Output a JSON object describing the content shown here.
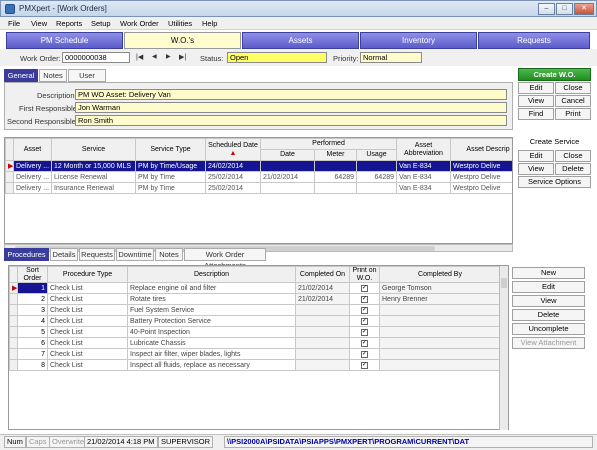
{
  "window": {
    "title": "PMXpert - [Work Orders]",
    "min": "–",
    "max": "□",
    "close": "✕"
  },
  "menu": [
    "File",
    "View",
    "Reports",
    "Setup",
    "Work Order",
    "Utilities",
    "Help"
  ],
  "main_tabs": [
    "PM Schedule",
    "W.O.'s",
    "Assets",
    "Inventory",
    "Requests"
  ],
  "order": {
    "work_order_label": "Work Order:",
    "work_order_value": "0000000038",
    "nav": [
      "|◀",
      "◀",
      "▶",
      "▶|"
    ],
    "status_label": "Status:",
    "status_value": "Open",
    "priority_label": "Priority:",
    "priority_value": "Normal"
  },
  "general_tabs": [
    "General",
    "Notes",
    "User Fields"
  ],
  "general": {
    "description_label": "Description:",
    "description_value": "PM WO Asset: Delivery Van",
    "first_resp_label": "First Responsible:",
    "first_resp_value": "Jon Warman",
    "second_resp_label": "Second Responsible:",
    "second_resp_value": "Ron Smith"
  },
  "wo_buttons": {
    "create": "Create W.O.",
    "edit": "Edit",
    "close": "Close",
    "view": "View",
    "cancel": "Cancel",
    "find": "Find",
    "print": "Print"
  },
  "service_buttons": {
    "create": "Create Service",
    "edit": "Edit",
    "close": "Close",
    "view": "View",
    "delete": "Delete",
    "options": "Service Options"
  },
  "grid1": {
    "headers": {
      "asset": "Asset",
      "service": "Service",
      "service_type": "Service Type",
      "scheduled": "Scheduled Date",
      "performed": "Performed",
      "date": "Date",
      "meter": "Meter",
      "usage": "Usage",
      "abbrev": "Asset Abbreviation",
      "desc": "Asset Descrip"
    },
    "rows": [
      {
        "asset": "Delivery ...",
        "service": "12 Month or 15,000 MLS",
        "type": "PM by Time/Usage",
        "scheduled": "24/02/2014",
        "date": "",
        "meter": "",
        "usage": "",
        "abbrev": "Van E-834",
        "desc": "Westpro Delive"
      },
      {
        "asset": "Delivery ...",
        "service": "License Renewal",
        "type": "PM by Time",
        "scheduled": "25/02/2014",
        "date": "21/02/2014",
        "meter": "64289",
        "usage": "64289",
        "abbrev": "Van E-834",
        "desc": "Westpro Delive"
      },
      {
        "asset": "Delivery ...",
        "service": "Insurance Renewal",
        "type": "PM by Time",
        "scheduled": "25/02/2014",
        "date": "",
        "meter": "",
        "usage": "",
        "abbrev": "Van E-834",
        "desc": "Westpro Delive"
      }
    ]
  },
  "proc_tabs": [
    "Procedures",
    "Details",
    "Requests",
    "Downtime",
    "Notes",
    "Work Order Attachments"
  ],
  "grid2": {
    "headers": {
      "sort": "Sort Order",
      "type": "Procedure Type",
      "desc": "Description",
      "completed_on": "Completed On",
      "print": "Print on W.O.",
      "completed_by": "Completed By"
    },
    "rows": [
      {
        "sort": "1",
        "type": "Check List",
        "desc": "Replace engine oil and filter",
        "on": "21/02/2014",
        "print": "✓",
        "by": "George Tomson"
      },
      {
        "sort": "2",
        "type": "Check List",
        "desc": "Rotate tires",
        "on": "21/02/2014",
        "print": "✓",
        "by": "Henry Brenner"
      },
      {
        "sort": "3",
        "type": "Check List",
        "desc": "Fuel System Service",
        "on": "",
        "print": "✓",
        "by": ""
      },
      {
        "sort": "4",
        "type": "Check List",
        "desc": "Battery Protection Service",
        "on": "",
        "print": "✓",
        "by": ""
      },
      {
        "sort": "5",
        "type": "Check List",
        "desc": "40-Point Inspection",
        "on": "",
        "print": "✓",
        "by": ""
      },
      {
        "sort": "6",
        "type": "Check List",
        "desc": "Lubricate Chassis",
        "on": "",
        "print": "✓",
        "by": ""
      },
      {
        "sort": "7",
        "type": "Check List",
        "desc": "Inspect air filter, wiper blades, lights",
        "on": "",
        "print": "✓",
        "by": ""
      },
      {
        "sort": "8",
        "type": "Check List",
        "desc": "Inspect all fluids, replace as necessary",
        "on": "",
        "print": "✓",
        "by": ""
      }
    ]
  },
  "proc_buttons": {
    "new": "New",
    "edit": "Edit",
    "view": "View",
    "delete": "Delete",
    "uncomplete": "Uncomplete",
    "attachment": "View Attachment"
  },
  "status": {
    "num": "Num",
    "caps": "Caps",
    "overwrite": "Overwrite",
    "datetime": "21/02/2014 4:18 PM",
    "user": "SUPERVISOR",
    "path": "\\\\PSI2000A\\PSIDATA\\PSIAPPS\\PMXPERT\\PROGRAM\\CURRENT\\DAT"
  }
}
